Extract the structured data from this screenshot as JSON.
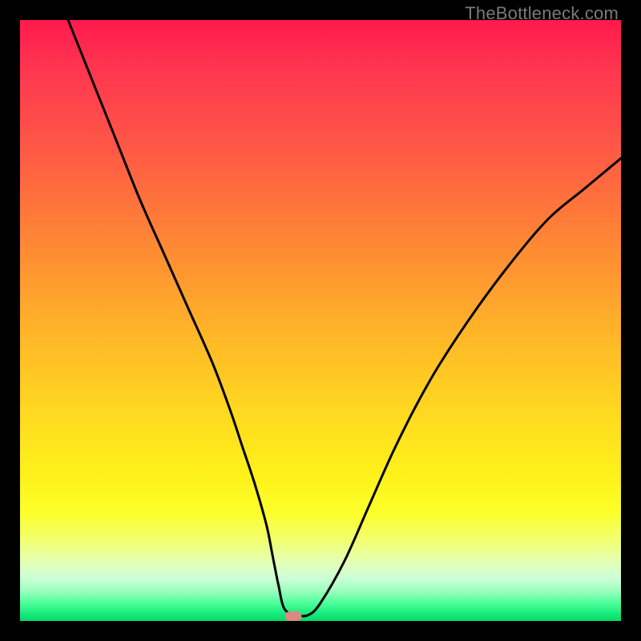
{
  "watermark": "TheBottleneck.com",
  "chart_data": {
    "type": "line",
    "title": "",
    "xlabel": "",
    "ylabel": "",
    "xlim": [
      0,
      100
    ],
    "ylim": [
      0,
      100
    ],
    "grid": false,
    "series": [
      {
        "name": "curve",
        "x": [
          8,
          12,
          16,
          20,
          24,
          28,
          32,
          35,
          37,
          39,
          41,
          42,
          43,
          44,
          46,
          48,
          50,
          54,
          58,
          62,
          66,
          70,
          76,
          82,
          88,
          94,
          100
        ],
        "y": [
          100,
          90,
          80,
          70,
          61,
          52,
          43,
          35,
          29,
          23,
          16,
          11,
          6,
          2,
          1,
          1,
          3,
          10,
          19,
          28,
          36,
          43,
          52,
          60,
          67,
          72,
          77
        ]
      }
    ],
    "marker": {
      "x": 45.5,
      "y": 0.8
    },
    "gradient_colors": {
      "top": "#ff1a4d",
      "mid": "#ffe21a",
      "bottom": "#0ad86a"
    }
  }
}
